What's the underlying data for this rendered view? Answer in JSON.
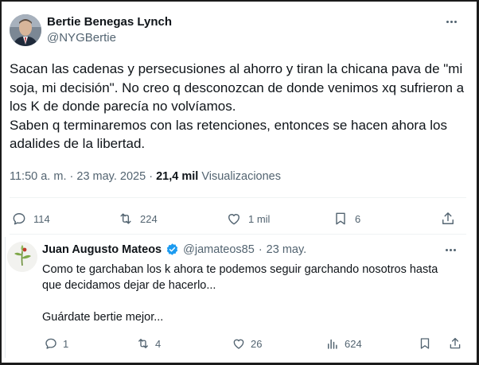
{
  "tweet": {
    "author_name": "Bertie Benegas Lynch",
    "author_handle": "@NYGBertie",
    "text_lines": [
      "Sacan las cadenas y persecusiones al ahorro y tiran la chicana pava de \"mi soja, mi decisión\". No creo q desconozcan de donde venimos xq sufrieron a los K de donde parecía no volvíamos.",
      "Saben q terminaremos con las retenciones, entonces se hacen ahora los adalides de la libertad."
    ],
    "time": "11:50 a. m.",
    "separator": "·",
    "date": "23 may. 2025",
    "views_count": "21,4 mil",
    "views_label": "Visualizaciones",
    "replies": "114",
    "reposts": "224",
    "likes": "1 mil",
    "bookmarks": "6"
  },
  "reply": {
    "author_name": "Juan Augusto Mateos",
    "author_handle": "@jamateos85",
    "separator": "·",
    "date": "23 may.",
    "text_line1": "Como te garchaban los k ahora te podemos seguir garchando nosotros hasta que decidamos dejar de hacerlo...",
    "text_line2": "Guárdate bertie mejor...",
    "replies": "1",
    "reposts": "4",
    "likes": "26",
    "views": "624"
  },
  "colors": {
    "text_primary": "#0f1419",
    "text_secondary": "#536471",
    "verified_blue": "#1d9bf0",
    "divider": "#eff3f4"
  },
  "icons": [
    "more-icon",
    "reply-icon",
    "repost-icon",
    "like-icon",
    "bookmark-icon",
    "share-icon",
    "verified-icon",
    "views-icon"
  ]
}
